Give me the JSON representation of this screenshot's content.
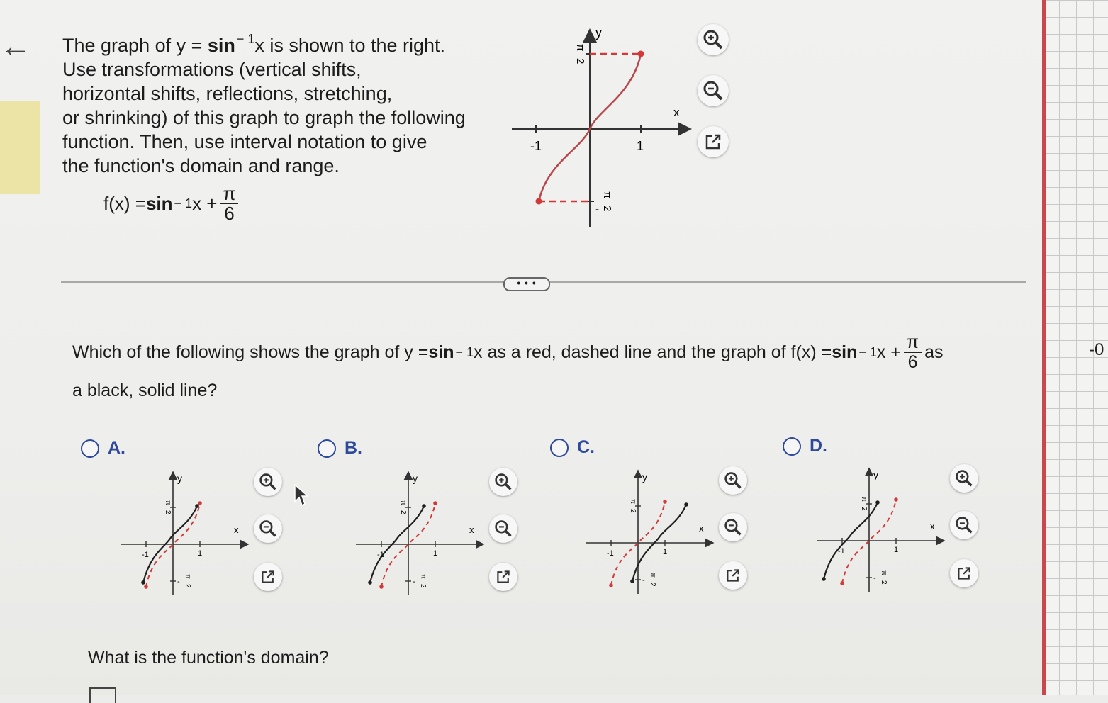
{
  "prompt": {
    "line1_pre": "The graph of y = ",
    "line1_fn": "sin",
    "line1_exp": "− 1",
    "line1_post": "x  is shown to the right.",
    "line2": "Use transformations (vertical shifts,",
    "line3": "horizontal shifts, reflections, stretching,",
    "line4": "or shrinking) of this graph to graph the following",
    "line5": "function.  Then, use interval notation to give",
    "line6": "the function's domain and range."
  },
  "function": {
    "lhs": "f(x) = ",
    "fn": "sin",
    "exp": "− 1",
    "var": "x + ",
    "num": "π",
    "den": "6"
  },
  "main_graph": {
    "y_label": "y",
    "x_label": "x",
    "x_neg": "-1",
    "x_pos": "1",
    "y_top_num": "π",
    "y_top_den": "2",
    "y_bot_sign": "-",
    "y_bot_num": "π",
    "y_bot_den": "2"
  },
  "more_button": "• • •",
  "question": {
    "part1": "Which of the following shows the graph of y = ",
    "fn1": "sin",
    "exp1": "− 1",
    "part2": "x  as a red, dashed line and the graph of f(x) = ",
    "fn2": "sin",
    "exp2": "− 1",
    "part3": "x + ",
    "num": "π",
    "den": "6",
    "part4": " as",
    "line2": "a black, solid line?"
  },
  "options": [
    {
      "label": "A."
    },
    {
      "label": "B."
    },
    {
      "label": "C."
    },
    {
      "label": "D."
    }
  ],
  "option_graph_text": {
    "y": "y",
    "x": "x",
    "one": "1",
    "neg_one": "-1",
    "pi": "π",
    "two": "2",
    "neg_pi_sign": "-"
  },
  "domain_question": "What is the function's domain?",
  "grid_paper_label": "-0",
  "colors": {
    "accent_blue": "#2f4a9c",
    "red_curve": "#d23a3a",
    "black_curve": "#1f1f1f"
  },
  "icons": [
    "zoom-in-icon",
    "zoom-out-icon",
    "external-link-icon"
  ]
}
